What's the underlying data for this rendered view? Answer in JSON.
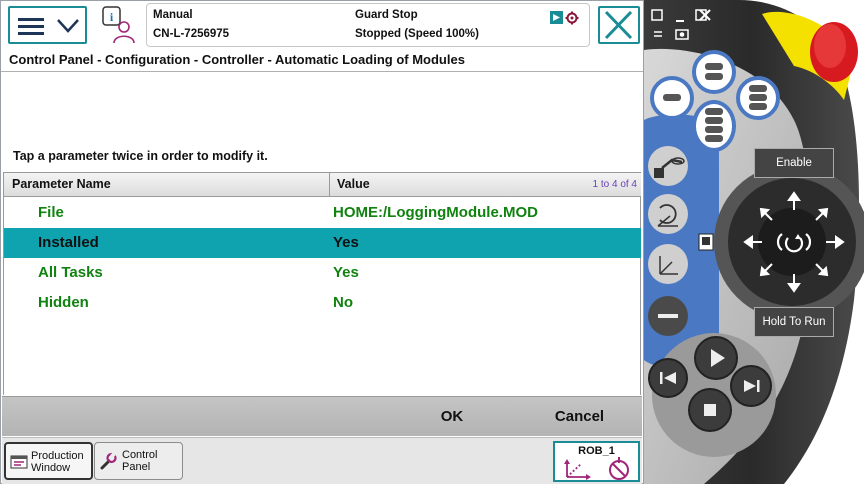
{
  "status": {
    "mode": "Manual",
    "controller_id": "CN-L-7256975",
    "stop_state": "Guard Stop",
    "speed_state": "Stopped (Speed 100%)"
  },
  "breadcrumb": "Control Panel - Configuration - Controller - Automatic Loading of Modules",
  "instruction": "Tap a parameter twice in order to modify it.",
  "table": {
    "col_name": "Parameter Name",
    "col_value": "Value",
    "range": "1 to 4 of 4",
    "rows": [
      {
        "name": "File",
        "value": "HOME:/LoggingModule.MOD",
        "selected": false
      },
      {
        "name": "Installed",
        "value": "Yes",
        "selected": true
      },
      {
        "name": "All Tasks",
        "value": "Yes",
        "selected": false
      },
      {
        "name": "Hidden",
        "value": "No",
        "selected": false
      }
    ]
  },
  "actions": {
    "ok": "OK",
    "cancel": "Cancel"
  },
  "taskbar": {
    "production_line1": "Production",
    "production_line2": "Window",
    "control_line1": "Control",
    "control_line2": "Panel",
    "rob": "ROB_1"
  },
  "pendant": {
    "enable": "Enable",
    "hold_to_run": "Hold To Run"
  },
  "colors": {
    "accent": "#1a8c96",
    "selected_row": "#0fa3b0",
    "param_text": "#10820f",
    "pendant_blue": "#4a78c2",
    "estop_red": "#d71920",
    "estop_yellow": "#f4e100"
  },
  "icons": [
    "menu-icon",
    "chevron-down-icon",
    "info-user-icon",
    "close-icon",
    "production-window-icon",
    "wrench-icon",
    "jog-axes-icon",
    "no-entry-icon",
    "joystick-arrows-icon",
    "play-icon",
    "stop-icon",
    "step-back-icon",
    "step-forward-icon"
  ]
}
